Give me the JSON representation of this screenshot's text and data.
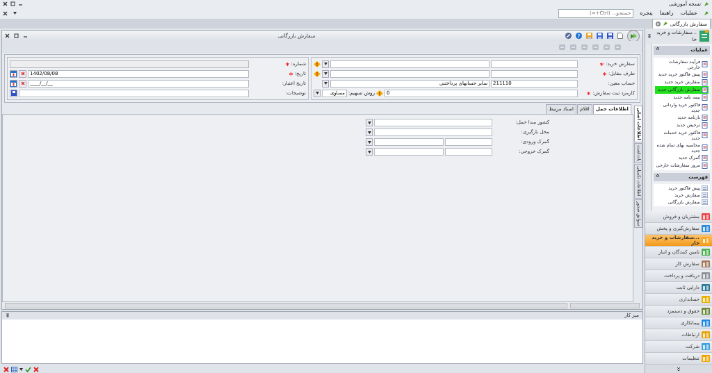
{
  "app_title": "نسخه آموزشی",
  "menu": [
    "عملیات",
    "راهنما",
    "پنجره"
  ],
  "search": {
    "placeholder": "جستجو... (Ctrl+=)"
  },
  "doc_tabs": [
    {
      "label": "سفارش بازرگانی",
      "selected": true
    }
  ],
  "window": {
    "title": "سفارش بازرگانی"
  },
  "main_fields": [
    {
      "kind": "lookup",
      "label": "سفارش خرید:",
      "required": true,
      "warning": true
    },
    {
      "kind": "lookup",
      "label": "طرف مقابل:",
      "required": true,
      "warning": true
    },
    {
      "kind": "lookup",
      "label": "حساب معین:",
      "required": false,
      "code": "211110",
      "value": "سایر حسابهای پرداختنی",
      "warning": false
    },
    {
      "kind": "fee",
      "label": "کارمزد ثبت سفارش:",
      "required": true,
      "value": "0",
      "warning": true,
      "method_label": "روش تسهیم:",
      "method_value": "مساوی"
    }
  ],
  "side_fields": [
    {
      "kind": "readonly",
      "label": "شماره:",
      "required": true
    },
    {
      "kind": "date",
      "label": "تاریخ:",
      "required": true,
      "value": "1402/08/08"
    },
    {
      "kind": "date",
      "label": "تاریخ اعتبار:",
      "required": false,
      "value": "____/__/__"
    },
    {
      "kind": "text",
      "label": "توضیحات:",
      "required": false
    }
  ],
  "sub_tabs": [
    {
      "label": "اطلاعات حمل",
      "selected": true
    },
    {
      "label": "اقلام",
      "selected": false
    },
    {
      "label": "اسناد مرتبط",
      "selected": false
    }
  ],
  "shipping_fields": [
    {
      "kind": "lookup",
      "label": "کشور مبدا حمل:"
    },
    {
      "kind": "lookup",
      "label": "محل بارگیری:"
    },
    {
      "kind": "coded",
      "label": "گمرک ورودی:"
    },
    {
      "kind": "coded",
      "label": "گمرک خروجی:"
    }
  ],
  "side_tabs": [
    {
      "label": "اطلاعات اصلی",
      "selected": true
    },
    {
      "label": "یادداشت",
      "selected": false
    },
    {
      "label": "اطلاعات تکمیلی",
      "selected": false
    },
    {
      "label": "سوابق صدور",
      "selected": false
    }
  ],
  "desk_panel": {
    "title": "میز کار"
  },
  "nav": {
    "title": "...سفارشات و خرید خا",
    "groups": [
      {
        "title": "عملیات",
        "items": [
          {
            "label": "فرآیند سفارشات خارجی",
            "selected": false
          },
          {
            "label": "پیش فاکتور خرید جدید",
            "selected": false
          },
          {
            "label": "سفارش خرید جدید",
            "selected": false
          },
          {
            "label": "سفارش بازرگانی جدید",
            "selected": true
          },
          {
            "label": "بیمه نامه جدید",
            "selected": false
          },
          {
            "label": "فاکتور خرید وارداتی جدید",
            "selected": false
          },
          {
            "label": "بارنامه جدید",
            "selected": false
          },
          {
            "label": "ترخیص جدید",
            "selected": false
          },
          {
            "label": "فاکتور خرید خدمات جدید",
            "selected": false
          },
          {
            "label": "محاسبه بهای تمام شده جدید",
            "selected": false
          },
          {
            "label": "گمرک جدید",
            "selected": false
          },
          {
            "label": "مرور سفارشات خارجی",
            "selected": false
          }
        ]
      },
      {
        "title": "فهرست",
        "items": [
          {
            "label": "پیش فاکتور خرید",
            "selected": false
          },
          {
            "label": "سفارش خرید",
            "selected": false
          },
          {
            "label": "سفارش بازرگانی",
            "selected": false
          }
        ]
      }
    ],
    "modules": [
      {
        "label": "مشتریان و فروش",
        "selected": false
      },
      {
        "label": "سفارش‌گیری و پخش",
        "selected": false
      },
      {
        "label": "...سفارشات و خرید خار",
        "selected": true
      },
      {
        "label": "تامین کنندگان و انبار",
        "selected": false
      },
      {
        "label": "سفارش کار",
        "selected": false
      },
      {
        "label": "دریافت و پرداخت",
        "selected": false
      },
      {
        "label": "دارایی ثابت",
        "selected": false
      },
      {
        "label": "حسابداری",
        "selected": false
      },
      {
        "label": "حقوق و دستمزد",
        "selected": false
      },
      {
        "label": "پیمانکاری",
        "selected": false
      },
      {
        "label": "ارتباطات",
        "selected": false
      },
      {
        "label": "شرکت",
        "selected": false
      },
      {
        "label": "تنظیمات",
        "selected": false
      }
    ]
  }
}
